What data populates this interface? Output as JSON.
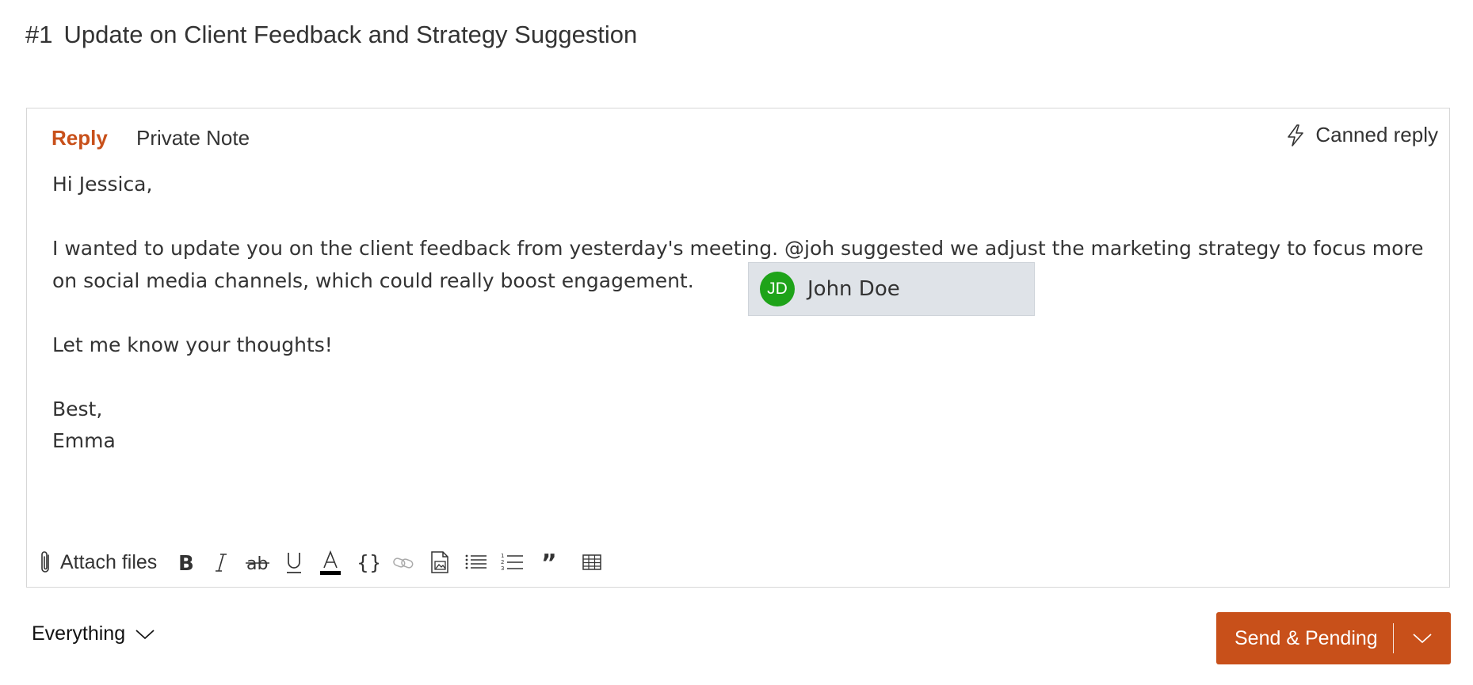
{
  "header": {
    "ticket_number": "#1",
    "title": "Update on Client Feedback and Strategy Suggestion"
  },
  "editor": {
    "tabs": [
      {
        "label": "Reply",
        "active": true
      },
      {
        "label": "Private Note",
        "active": false
      }
    ],
    "canned_reply_label": "Canned reply",
    "body_lines": [
      "Hi Jessica,",
      "",
      "I wanted to update you on the client feedback from yesterday's meeting. @joh suggested we adjust the marketing strategy to focus more on social media channels, which could really boost engagement.",
      "",
      "Let me know your thoughts!",
      "",
      "Best,",
      "Emma"
    ],
    "mention_suggestion": {
      "initials": "JD",
      "name": "John Doe",
      "avatar_color": "#1ea319"
    },
    "toolbar": {
      "attach_label": "Attach files",
      "tools": [
        "bold-icon",
        "italic-icon",
        "strikethrough-icon",
        "underline-icon",
        "text-color-icon",
        "code-braces-icon",
        "link-icon",
        "image-icon",
        "bullet-list-icon",
        "numbered-list-icon",
        "quote-icon",
        "table-icon"
      ]
    }
  },
  "footer": {
    "filter_label": "Everything",
    "send_label": "Send & Pending"
  },
  "colors": {
    "accent": "#c8501a",
    "mention_bg": "#dfe3e8"
  }
}
